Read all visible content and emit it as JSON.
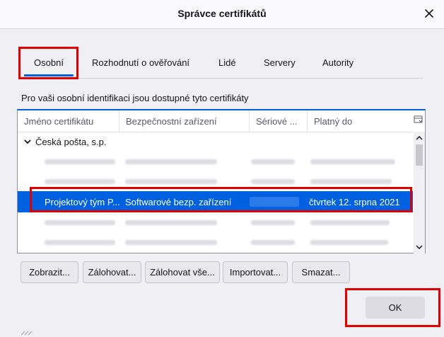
{
  "dialog": {
    "title": "Správce certifikátů"
  },
  "tabs": [
    {
      "label": "Osobní",
      "active": true
    },
    {
      "label": "Rozhodnutí o ověřování",
      "active": false
    },
    {
      "label": "Lidé",
      "active": false
    },
    {
      "label": "Servery",
      "active": false
    },
    {
      "label": "Autority",
      "active": false
    }
  ],
  "description": "Pro vaši osobní identifikaci jsou dostupné tyto certifikáty",
  "columns": [
    "Jméno certifikátu",
    "Bezpečnostní zařízení",
    "Sériové ...",
    "Platný do"
  ],
  "group": {
    "label": "Česká pošta, s.p.",
    "expanded": true
  },
  "selected_row": {
    "name": "Projektový tým P...",
    "device": "Softwarové bezp. zařízení",
    "serial": "",
    "valid_until": "čtvrtek 12. srpna 2021"
  },
  "buttons": {
    "view": "Zobrazit...",
    "backup": "Zálohovat...",
    "backup_all": "Zálohovat vše...",
    "import": "Importovat...",
    "delete": "Smazat...",
    "ok": "OK"
  },
  "colors": {
    "accent": "#0061e0",
    "highlight_box": "#e00000",
    "background": "#f0f0f4"
  }
}
